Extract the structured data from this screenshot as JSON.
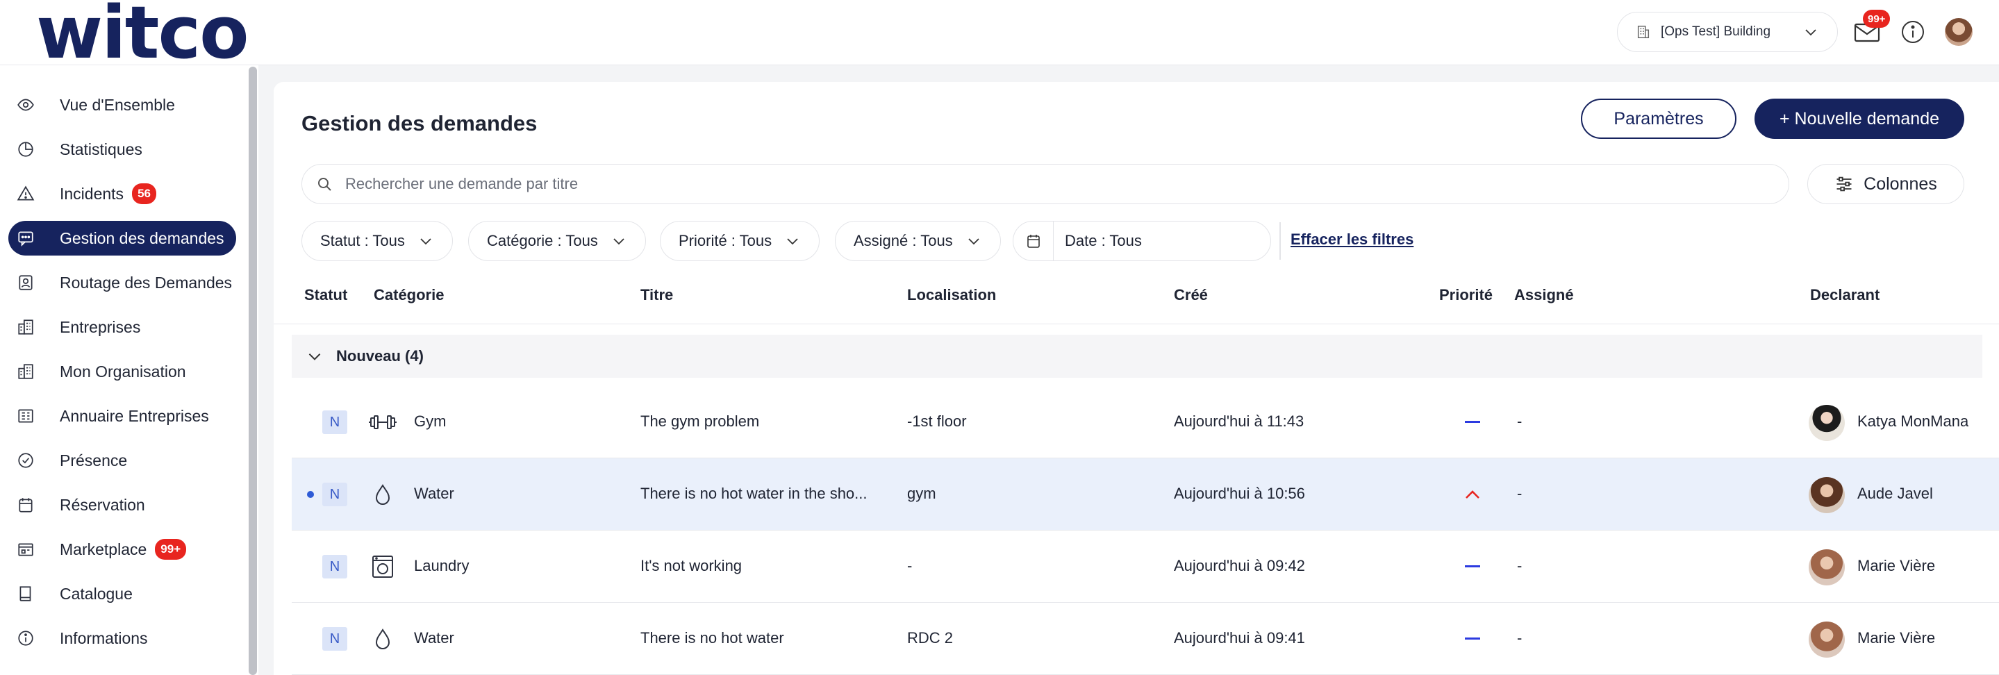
{
  "app": {
    "logo": "witco"
  },
  "header": {
    "building": "[Ops Test] Building",
    "mail_badge": "99+"
  },
  "sidebar": {
    "items": [
      {
        "label": "Vue d'Ensemble",
        "icon": "eye-icon"
      },
      {
        "label": "Statistiques",
        "icon": "pie-chart-icon"
      },
      {
        "label": "Incidents",
        "icon": "warning-icon",
        "badge": "56"
      },
      {
        "label": "Gestion des demandes",
        "icon": "chat-icon",
        "active": true
      },
      {
        "label": "Routage des Demandes",
        "icon": "routing-icon"
      },
      {
        "label": "Entreprises",
        "icon": "buildings-icon"
      },
      {
        "label": "Mon Organisation",
        "icon": "organisation-icon"
      },
      {
        "label": "Annuaire Entreprises",
        "icon": "directory-icon"
      },
      {
        "label": "Présence",
        "icon": "check-circle-icon"
      },
      {
        "label": "Réservation",
        "icon": "calendar-icon"
      },
      {
        "label": "Marketplace",
        "icon": "shop-icon",
        "badge": "99+"
      },
      {
        "label": "Catalogue",
        "icon": "book-icon"
      },
      {
        "label": "Informations",
        "icon": "info-icon"
      }
    ]
  },
  "main": {
    "title": "Gestion des demandes",
    "settings_button": "Paramètres",
    "new_button": "+ Nouvelle demande",
    "search_placeholder": "Rechercher une demande par titre",
    "columns_button": "Colonnes",
    "filters": {
      "statut": "Statut : Tous",
      "categorie": "Catégorie : Tous",
      "priorite": "Priorité : Tous",
      "assigne": "Assigné : Tous",
      "date": "Date : Tous",
      "clear": "Effacer les filtres"
    },
    "table": {
      "headers": {
        "statut": "Statut",
        "categorie": "Catégorie",
        "titre": "Titre",
        "localisation": "Localisation",
        "cree": "Créé",
        "priorite": "Priorité",
        "assigne": "Assigné",
        "declarant": "Declarant"
      },
      "group_label": "Nouveau (4)",
      "rows": [
        {
          "status": "N",
          "category": "Gym",
          "category_icon": "dumbbell-icon",
          "title": "The gym problem",
          "location": "-1st floor",
          "created": "Aujourd'hui à 11:43",
          "priority": "medium",
          "assignee": "-",
          "declarant": "Katya MonMana",
          "unread": false
        },
        {
          "status": "N",
          "category": "Water",
          "category_icon": "water-drop-icon",
          "title": "There is no hot water in the sho...",
          "location": "gym",
          "created": "Aujourd'hui à 10:56",
          "priority": "high",
          "assignee": "-",
          "declarant": "Aude Javel",
          "unread": true
        },
        {
          "status": "N",
          "category": "Laundry",
          "category_icon": "washing-machine-icon",
          "title": "It's not working",
          "location": "-",
          "created": "Aujourd'hui à 09:42",
          "priority": "medium",
          "assignee": "-",
          "declarant": "Marie Vière",
          "unread": false
        },
        {
          "status": "N",
          "category": "Water",
          "category_icon": "water-drop-icon",
          "title": "There is no hot water",
          "location": "RDC 2",
          "created": "Aujourd'hui à 09:41",
          "priority": "medium",
          "assignee": "-",
          "declarant": "Marie Vière",
          "unread": false
        }
      ]
    }
  },
  "colors": {
    "brand": "#16235e",
    "badge": "#e8251f",
    "priority_medium": "#2c3be0",
    "priority_high": "#e8251f",
    "selected_row": "#eaf0fb"
  }
}
